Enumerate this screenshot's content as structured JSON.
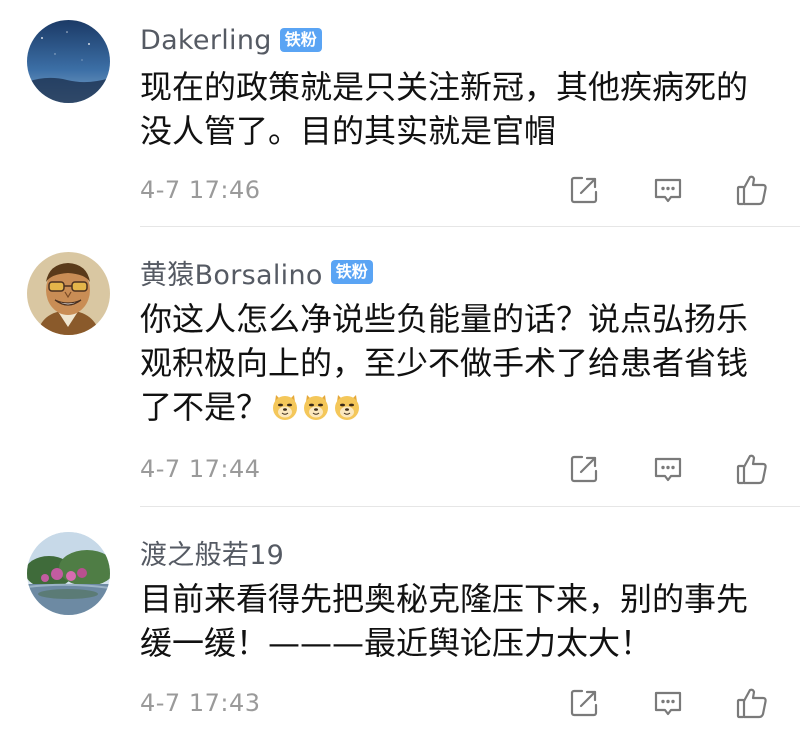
{
  "comments": [
    {
      "username": "Dakerling",
      "badge": "铁粉",
      "lines": [
        "现在的政策就是只关注新冠，其他疾病死的",
        "没人管了。目的其实就是官帽"
      ],
      "timestamp": "4-7 17:46"
    },
    {
      "username": "黄猿Borsalino",
      "badge": "铁粉",
      "lines": [
        "你这人怎么净说些负能量的话？说点弘扬乐",
        "观积极向上的，至少不做手术了给患者省钱",
        "了不是？"
      ],
      "emoji_icon": "doge-emoji-icon",
      "emoji_count": 3,
      "timestamp": "4-7 17:44"
    },
    {
      "username": "渡之般若19",
      "badge": "",
      "lines": [
        "目前来看得先把奥秘克隆压下来，别的事先",
        "缓一缓！———最近舆论压力太大！"
      ],
      "timestamp": "4-7 17:43"
    }
  ],
  "icons": {
    "share": "share-icon",
    "reply": "comment-icon",
    "like": "thumbs-up-icon"
  },
  "colors": {
    "badge": "#5aa4f4",
    "username": "#555a63",
    "timestamp": "#9a9a9a",
    "text": "#111111",
    "icon": "#7a7a7a"
  }
}
